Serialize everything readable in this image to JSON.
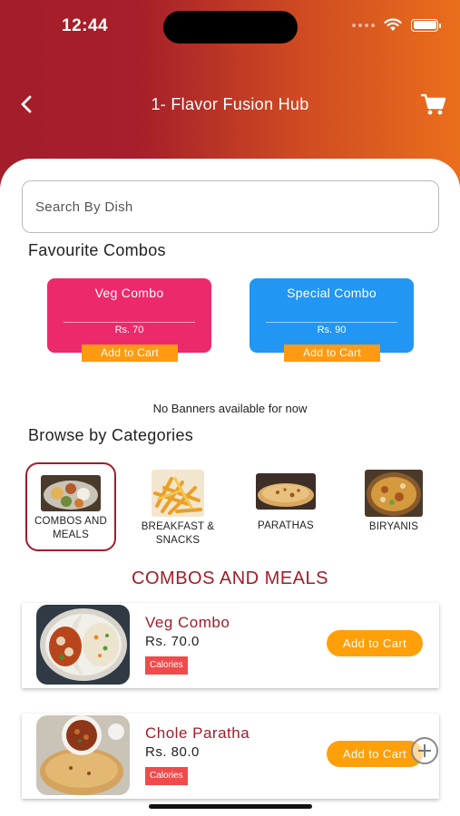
{
  "status_bar": {
    "time": "12:44"
  },
  "header": {
    "title": "1- Flavor Fusion Hub"
  },
  "search": {
    "placeholder": "Search By Dish"
  },
  "favourites": {
    "title": "Favourite Combos",
    "combos": [
      {
        "name": "Veg Combo",
        "price": "Rs. 70",
        "add_label": "Add to Cart",
        "color": "#ec2a6b"
      },
      {
        "name": "Special Combo",
        "price": "Rs. 90",
        "add_label": "Add to Cart",
        "color": "#2196f3"
      }
    ]
  },
  "banner": {
    "message": "No Banners available for now"
  },
  "categories": {
    "title": "Browse by Categories",
    "items": [
      {
        "label": "COMBOS AND MEALS",
        "selected": true
      },
      {
        "label": "BREAKFAST & SNACKS",
        "selected": false
      },
      {
        "label": "PARATHAS",
        "selected": false
      },
      {
        "label": "BIRYANIS",
        "selected": false
      }
    ]
  },
  "list": {
    "heading": "COMBOS AND MEALS",
    "items": [
      {
        "name": "Veg Combo",
        "price": "Rs. 70.0",
        "tag": "Calories",
        "add_label": "Add to Cart"
      },
      {
        "name": "Chole Paratha",
        "price": "Rs. 80.0",
        "tag": "Calories",
        "add_label": "Add to Cart"
      }
    ]
  },
  "colors": {
    "brand_dark": "#a41d2a",
    "brand_orange": "#ea6f1c",
    "button_orange": "#ff9f0a",
    "tag_red": "#ef4b4b"
  },
  "icons": [
    "back-arrow-icon",
    "cart-icon",
    "wifi-icon",
    "battery-icon",
    "plus-icon"
  ]
}
